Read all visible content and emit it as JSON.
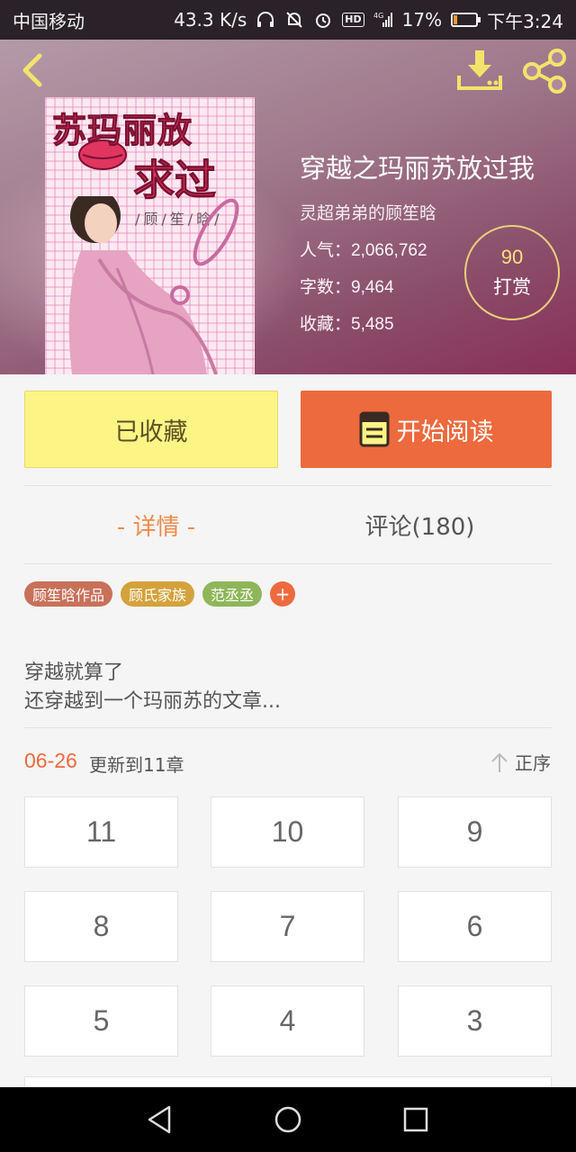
{
  "status_bar": {
    "carrier": "中国移动",
    "speed": "43.3 K/s",
    "hd": "HD",
    "network": "4G",
    "battery_pct": "17%",
    "battery_level": 0.17,
    "time": "下午3:24"
  },
  "header": {
    "back_icon": "chevron-left-icon",
    "download_icon": "download-icon",
    "share_icon": "share-icon"
  },
  "cover": {
    "title_line1": "苏玛丽放",
    "title_line2": "求过",
    "author_text": "/顾/笙/晗/"
  },
  "book": {
    "title": "穿越之玛丽苏放过我",
    "author": "灵超弟弟的顾笙晗",
    "popularity_label": "人气：",
    "popularity": "2,066,762",
    "words_label": "字数：",
    "words": "9,464",
    "favorites_label": "收藏：",
    "favorites": "5,485"
  },
  "reward": {
    "count": "90",
    "label": "打赏"
  },
  "actions": {
    "collected_label": "已收藏",
    "read_label": "开始阅读"
  },
  "tabs": {
    "detail": "- 详情 -",
    "comments": "评论(180)"
  },
  "tags": [
    {
      "label": "顾笙晗作品",
      "color": "#c8715a"
    },
    {
      "label": "顾氏家族",
      "color": "#d4a23c"
    },
    {
      "label": "范丞丞",
      "color": "#8fb65a"
    }
  ],
  "tag_add_label": "+",
  "summary": {
    "line1": "穿越就算了",
    "line2": "还穿越到一个玛丽苏的文章..."
  },
  "chapters": {
    "update_date": "06-26",
    "update_text": "更新到11章",
    "sort_label": "正序",
    "items": [
      "11",
      "10",
      "9",
      "8",
      "7",
      "6",
      "5",
      "4",
      "3"
    ]
  },
  "colors": {
    "accent": "#ec6a3d",
    "collected_bg": "#fdf486",
    "reward_gold": "#ffe07a"
  }
}
